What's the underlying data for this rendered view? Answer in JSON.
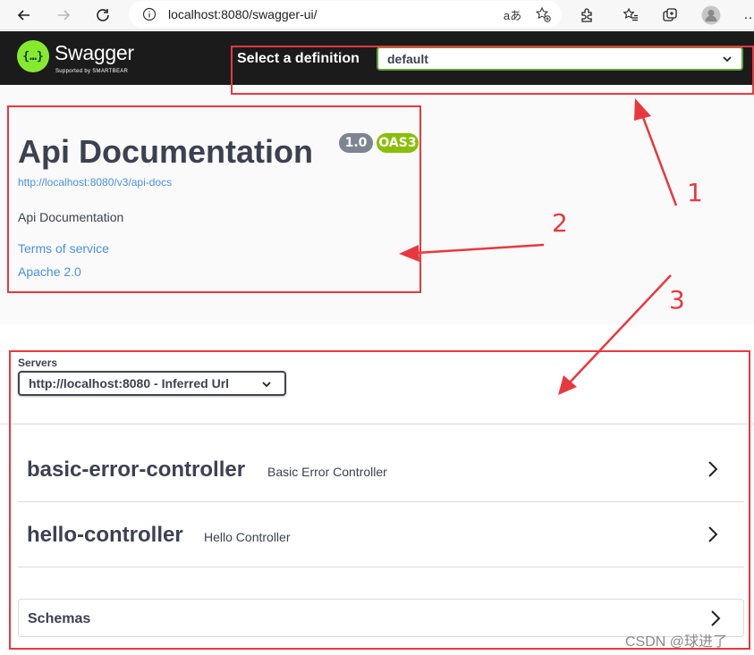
{
  "browser": {
    "url": "localhost:8080/swagger-ui/",
    "icons": [
      "back-icon",
      "forward-icon",
      "refresh-icon",
      "info-icon",
      "read-aloud-icon",
      "add-favorite-icon",
      "extensions-icon",
      "favorites-icon",
      "collections-icon",
      "profile-icon",
      "more-icon"
    ],
    "read_aloud_glyph": "aあ",
    "more_glyph": "…"
  },
  "topbar": {
    "logo_glyph": "{…}",
    "logo_text": "Swagger",
    "logo_subtext": "Supported by SMARTBEAR",
    "definition_label": "Select a definition",
    "definition_value": "default"
  },
  "info": {
    "title": "Api Documentation",
    "version": "1.0",
    "oas_badge": "OAS3",
    "docs_url": "http://localhost:8080/v3/api-docs",
    "description": "Api Documentation",
    "terms_link": "Terms of service",
    "license_link": "Apache 2.0"
  },
  "servers": {
    "label": "Servers",
    "selected": "http://localhost:8080 - Inferred Url"
  },
  "tags": [
    {
      "name": "basic-error-controller",
      "description": "Basic Error Controller"
    },
    {
      "name": "hello-controller",
      "description": "Hello Controller"
    }
  ],
  "schemas": {
    "label": "Schemas"
  },
  "annotations": {
    "n1": "1",
    "n2": "2",
    "n3": "3"
  },
  "watermark": "CSDN @球进了",
  "colors": {
    "topbar_bg": "#1b1b1b",
    "swagger_green": "#85ea2d",
    "select_border": "#62a03f",
    "link": "#4990e2",
    "version_badge": "#7d8492",
    "oas_badge": "#89bf04",
    "annotation_red": "#e8383f"
  }
}
